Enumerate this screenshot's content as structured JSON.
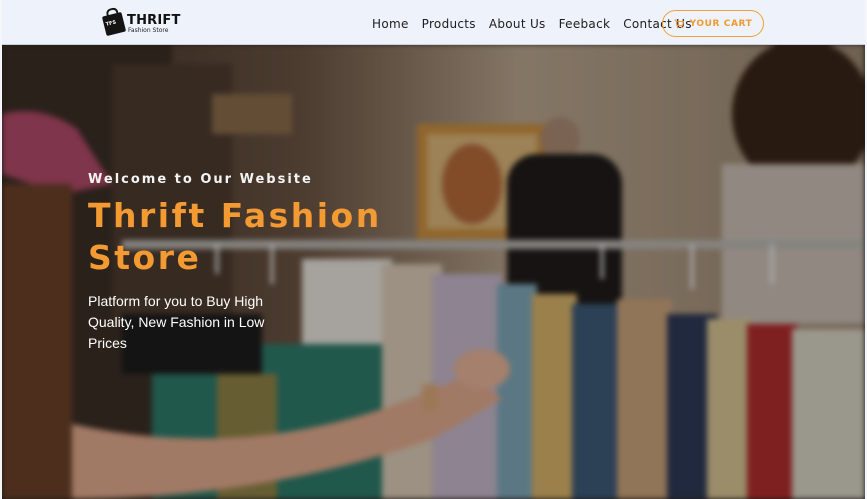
{
  "brand": {
    "title": "THRIFT",
    "subtitle": "Fashion Store",
    "bag_text": "TFS"
  },
  "nav": {
    "items": [
      "Home",
      "Products",
      "About Us",
      "Feeback",
      "Contact Us"
    ]
  },
  "cart": {
    "label": "YOUR CART",
    "icon": "cart-icon"
  },
  "hero": {
    "welcome": "Welcome to Our Website",
    "title_line1": "Thrift Fashion",
    "title_line2": "Store",
    "description": "Platform for you to Buy High Quality, New Fashion in Low Prices",
    "image": "clothing-rack-photo"
  },
  "colors": {
    "accent": "#f39a33",
    "navbar_bg": "#edf2fb",
    "cart_border": "#f2a13a"
  }
}
